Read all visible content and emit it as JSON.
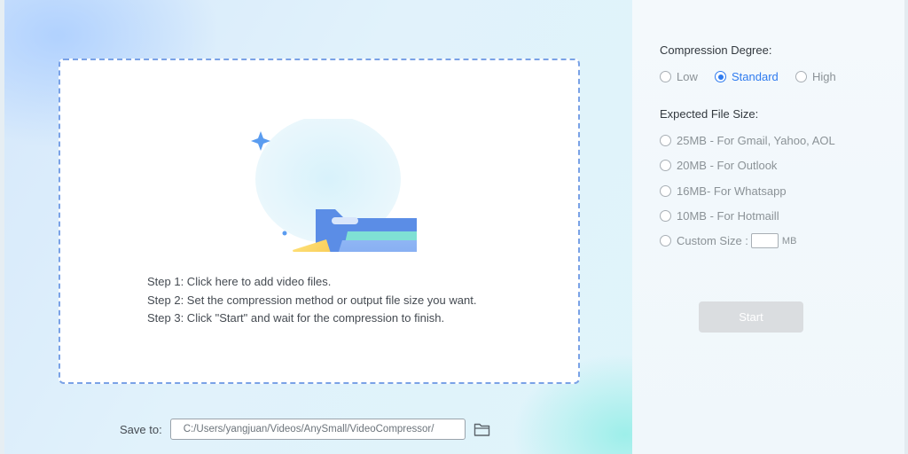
{
  "drop_zone": {
    "steps": [
      "Step 1: Click here to add video files.",
      "Step 2: Set the compression method or output file size you want.",
      "Step 3: Click \"Start\" and wait for the compression to finish."
    ]
  },
  "save": {
    "label": "Save to:",
    "path": "C:/Users/yangjuan/Videos/AnySmall/VideoCompressor/"
  },
  "compression": {
    "title": "Compression Degree:",
    "options": [
      "Low",
      "Standard",
      "High"
    ],
    "selected": "Standard"
  },
  "file_size": {
    "title": "Expected File Size:",
    "options": [
      "25MB - For Gmail, Yahoo, AOL",
      "20MB - For Outlook",
      "16MB- For Whatsapp",
      "10MB - For Hotmaill"
    ],
    "custom_label": "Custom Size :",
    "custom_unit": "MB"
  },
  "start_label": "Start",
  "colors": {
    "accent": "#2f7bef",
    "folder_back": "#5b8de6",
    "folder_front": "#7fa9f0",
    "play_badge": "#f7cf56",
    "teal_page": "#7fe0d4",
    "start_disabled": "#dadde0"
  }
}
